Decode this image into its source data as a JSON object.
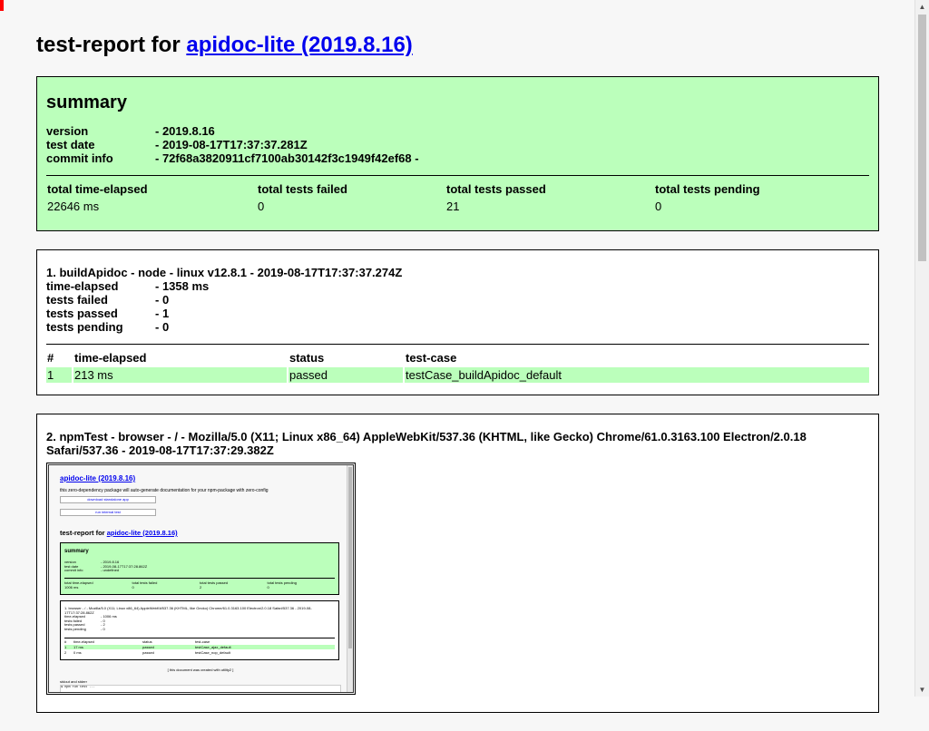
{
  "header": {
    "prefix": "test-report for",
    "link": "apidoc-lite (2019.8.16)"
  },
  "summary": {
    "heading": "summary",
    "fields": [
      {
        "label": "version",
        "value": "- 2019.8.16"
      },
      {
        "label": "test date",
        "value": "- 2019-08-17T17:37:37.281Z"
      },
      {
        "label": "commit info",
        "value": "- 72f68a3820911cf7100ab30142f3c1949f42ef68 -"
      }
    ],
    "columns": [
      "total time-elapsed",
      "total tests failed",
      "total tests passed",
      "total tests pending"
    ],
    "values": [
      "22646 ms",
      "0",
      "21",
      "0"
    ]
  },
  "tests": [
    {
      "title": "1. buildApidoc - node - linux v12.8.1 - 2019-08-17T17:37:37.274Z",
      "fields": [
        {
          "label": "time-elapsed",
          "value": "- 1358 ms"
        },
        {
          "label": "tests failed",
          "value": "- 0"
        },
        {
          "label": "tests passed",
          "value": "- 1"
        },
        {
          "label": "tests pending",
          "value": "- 0"
        }
      ],
      "columns": [
        "#",
        "time-elapsed",
        "status",
        "test-case"
      ],
      "rows": [
        {
          "num": "1",
          "time": "213 ms",
          "status": "passed",
          "case": "testCase_buildApidoc_default"
        }
      ]
    },
    {
      "title": "2. npmTest - browser - / - Mozilla/5.0 (X11; Linux x86_64) AppleWebKit/537.36 (KHTML, like Gecko) Chrome/61.0.3163.100 Electron/2.0.18 Safari/537.36 - 2019-08-17T17:37:29.382Z"
    }
  ],
  "screenshot": {
    "title": "apidoc-lite (2019.8.16)",
    "description": "this zero-dependency package will auto-generate documentation for your npm-package with zero-config",
    "button1": "download standalone app",
    "button2": "run internal test",
    "report_prefix": "test-report for",
    "report_link": "apidoc-lite (2019.8.16)",
    "summary_heading": "summary",
    "fields": [
      {
        "label": "version",
        "value": "- 2019.8.16"
      },
      {
        "label": "test date",
        "value": "- 2019-08-17T17:37:28.862Z"
      },
      {
        "label": "commit info",
        "value": "- undefined"
      }
    ],
    "columns": [
      "total time-elapsed",
      "total tests failed",
      "total tests passed",
      "total tests pending"
    ],
    "values": [
      "1006 ms",
      "0",
      "2",
      "0"
    ],
    "test_title": "1. browser - / - Mozilla/5.0 (X11; Linux x86_64) AppleWebKit/537.36 (KHTML, like Gecko) Chrome/61.0.3163.100 Electron/2.0.18 Safari/537.36 - 2019-08-17T17:37:28.862Z",
    "test_fields": [
      {
        "label": "time-elapsed",
        "value": "- 1006 ms"
      },
      {
        "label": "tests failed",
        "value": "- 0"
      },
      {
        "label": "tests passed",
        "value": "- 2"
      },
      {
        "label": "tests pending",
        "value": "- 0"
      }
    ],
    "rows": [
      {
        "num": "#",
        "time": "time-elapsed",
        "status": "status",
        "case": "test-case"
      },
      {
        "num": "1",
        "time": "17 ms",
        "status": "passed",
        "case": "testCase_ajax_default"
      },
      {
        "num": "2",
        "time": "0 ms",
        "status": "passed",
        "case": "testCase_nop_default"
      }
    ],
    "footer": "[ this document was created with utility2 ]",
    "log_label": "stdout and stderr",
    "log_text": "$ npm run test ..."
  }
}
